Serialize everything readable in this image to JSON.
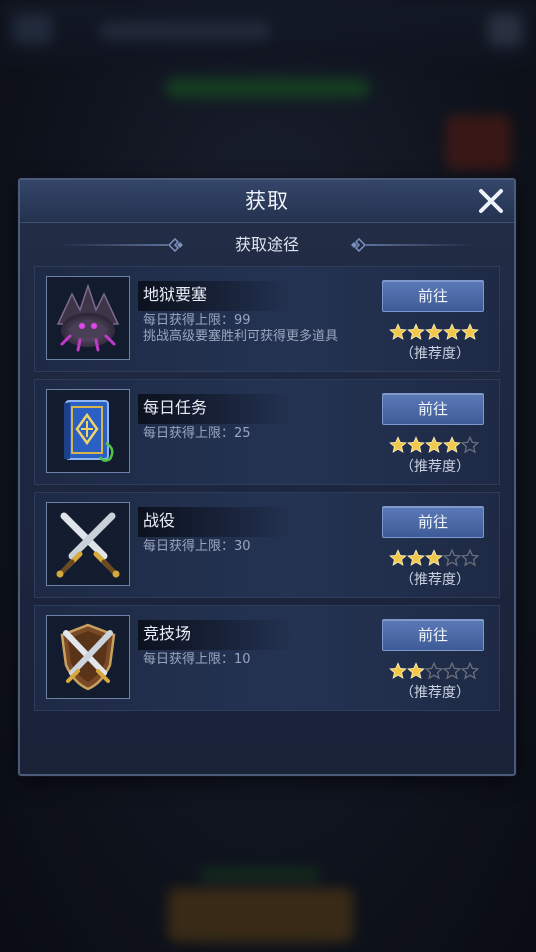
{
  "dialog": {
    "title": "获取",
    "subtitle": "获取途径",
    "rating_label": "（推荐度）",
    "items": [
      {
        "name": "地狱要塞",
        "desc_line1": "每日获得上限：99",
        "desc_line2": "挑战高级要塞胜利可获得更多道具",
        "button": "前往",
        "stars": 5,
        "icon": "fortress-dragon-icon"
      },
      {
        "name": "每日任务",
        "desc_line1": "每日获得上限：25",
        "desc_line2": "",
        "button": "前往",
        "stars": 4,
        "icon": "quest-book-icon"
      },
      {
        "name": "战役",
        "desc_line1": "每日获得上限：30",
        "desc_line2": "",
        "button": "前往",
        "stars": 3,
        "icon": "crossed-swords-icon"
      },
      {
        "name": "竞技场",
        "desc_line1": "每日获得上限：10",
        "desc_line2": "",
        "button": "前往",
        "stars": 2,
        "icon": "shield-swords-icon"
      }
    ]
  },
  "colors": {
    "star_filled": "#f2c84a",
    "star_empty": "#6a6f7d",
    "button_top": "#5a7ab7",
    "button_bottom": "#3d5b97"
  }
}
